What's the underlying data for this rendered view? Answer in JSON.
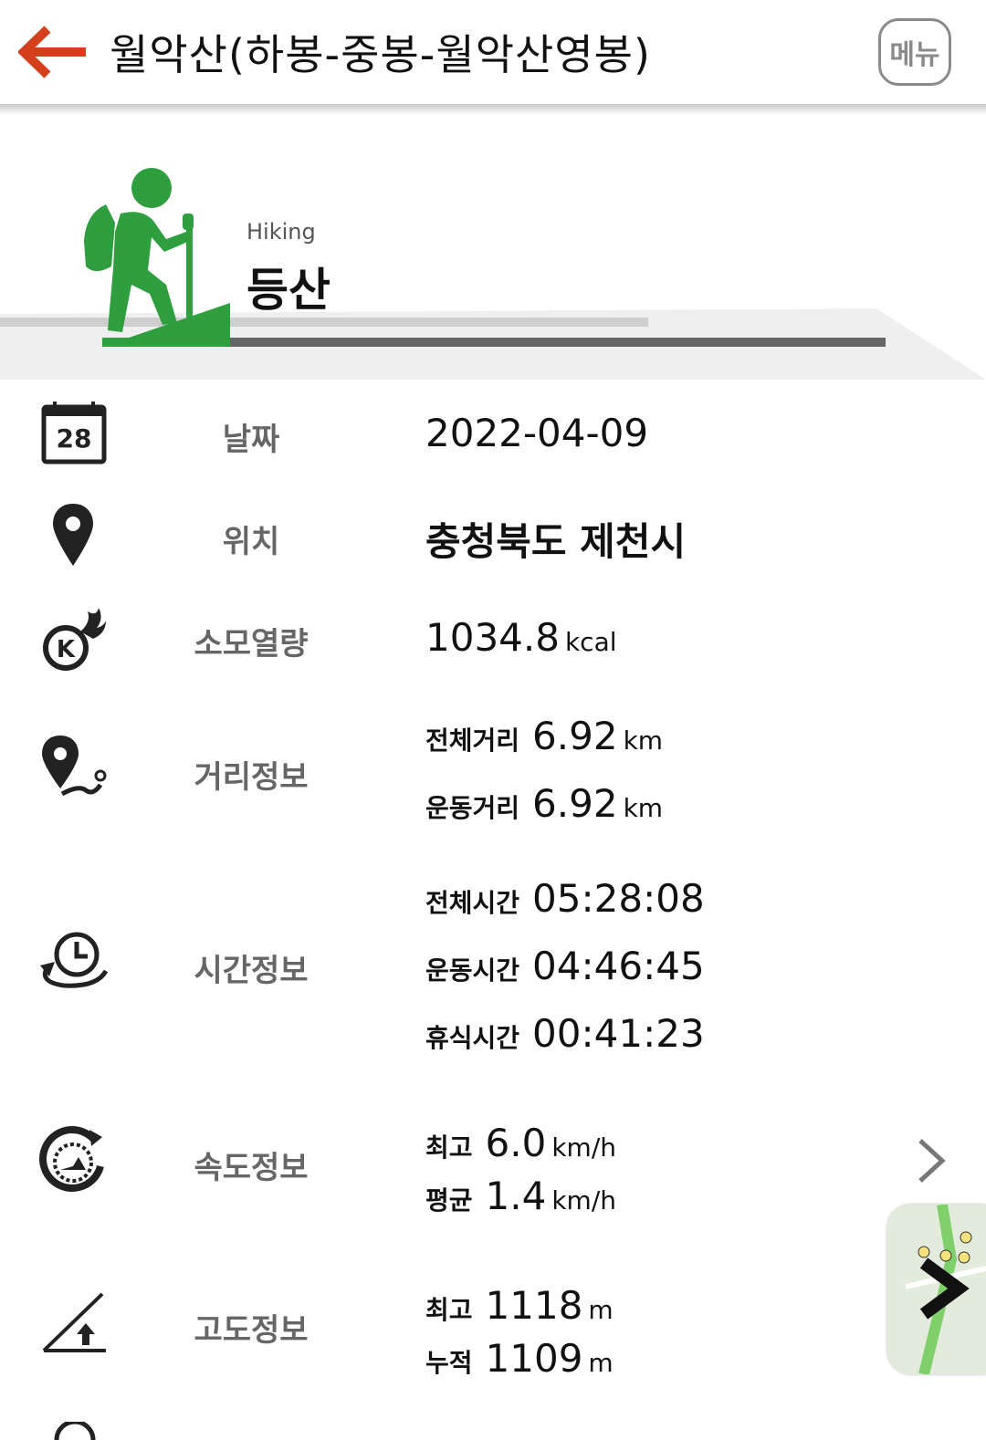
{
  "header": {
    "title": "월악산(하봉-중봉-월악산영봉)",
    "menu_label": "메뉴"
  },
  "activity": {
    "type_en": "Hiking",
    "type_ko": "등산",
    "icon": "hiker-icon",
    "accent_color": "#2e9e3e"
  },
  "date": {
    "label": "날짜",
    "value": "2022-04-09",
    "icon_day": "28"
  },
  "location": {
    "label": "위치",
    "value": "충청북도 제천시"
  },
  "calories": {
    "label": "소모열량",
    "value": "1034.8",
    "unit": "kcal"
  },
  "distance": {
    "label": "거리정보",
    "total_label": "전체거리",
    "total_value": "6.92",
    "total_unit": "km",
    "moving_label": "운동거리",
    "moving_value": "6.92",
    "moving_unit": "km"
  },
  "time": {
    "label": "시간정보",
    "total_label": "전체시간",
    "total_value": "05:28:08",
    "moving_label": "운동시간",
    "moving_value": "04:46:45",
    "rest_label": "휴식시간",
    "rest_value": "00:41:23"
  },
  "speed": {
    "label": "속도정보",
    "max_label": "최고",
    "max_value": "6.0",
    "max_unit": "km/h",
    "avg_label": "평균",
    "avg_value": "1.4",
    "avg_unit": "km/h"
  },
  "altitude": {
    "label": "고도정보",
    "max_label": "최고",
    "max_value": "1118",
    "max_unit": "m",
    "cum_label": "누적",
    "cum_value": "1109",
    "cum_unit": "m"
  },
  "colors": {
    "back_arrow": "#d4401c",
    "label_gray": "#666666"
  }
}
